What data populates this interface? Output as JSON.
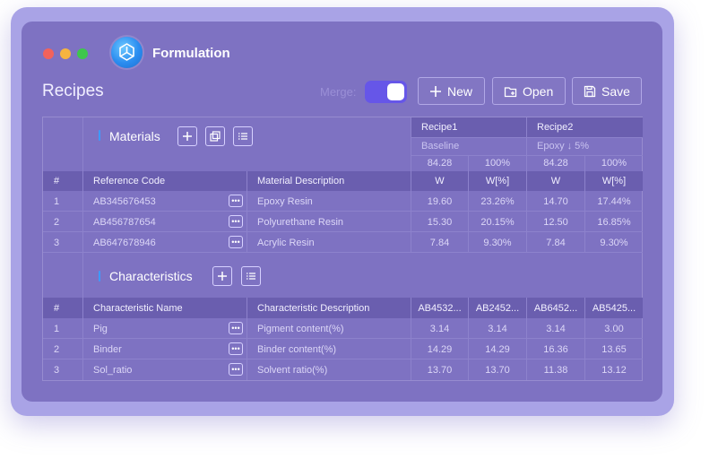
{
  "app": {
    "title": "Formulation"
  },
  "page": {
    "title": "Recipes"
  },
  "toolbar": {
    "merge_label": "Merge:",
    "new_label": "New",
    "open_label": "Open",
    "save_label": "Save"
  },
  "recipes": [
    {
      "name": "Recipe1",
      "subtitle": "Baseline",
      "total_w": "84.28",
      "total_pct": "100%"
    },
    {
      "name": "Recipe2",
      "subtitle": "Epoxy ↓ 5%",
      "total_w": "84.28",
      "total_pct": "100%"
    }
  ],
  "materials": {
    "title": "Materials",
    "headers": [
      "#",
      "Reference Code",
      "Material Description",
      "W",
      "W[%]",
      "W",
      "W[%]"
    ],
    "rows": [
      [
        "1",
        "AB345676453",
        "Epoxy Resin",
        "19.60",
        "23.26%",
        "14.70",
        "17.44%"
      ],
      [
        "2",
        "AB456787654",
        "Polyurethane Resin",
        "15.30",
        "20.15%",
        "12.50",
        "16.85%"
      ],
      [
        "3",
        "AB647678946",
        "Acrylic Resin",
        "7.84",
        "9.30%",
        "7.84",
        "9.30%"
      ]
    ]
  },
  "characteristics": {
    "title": "Characteristics",
    "headers": [
      "#",
      "Characteristic Name",
      "Characteristic Description",
      "AB4532...",
      "AB2452...",
      "AB6452...",
      "AB5425..."
    ],
    "rows": [
      [
        "1",
        "Pig",
        "Pigment content(%)",
        "3.14",
        "3.14",
        "3.14",
        "3.00"
      ],
      [
        "2",
        "Binder",
        "Binder content(%)",
        "14.29",
        "14.29",
        "16.36",
        "13.65"
      ],
      [
        "3",
        "Sol_ratio",
        "Solvent ratio(%)",
        "13.70",
        "13.70",
        "11.38",
        "13.12"
      ]
    ]
  },
  "more_button_label": "•••",
  "colors": {
    "accent": "#6656e8",
    "window": "#7e72c2",
    "header": "#6a5eaf"
  }
}
